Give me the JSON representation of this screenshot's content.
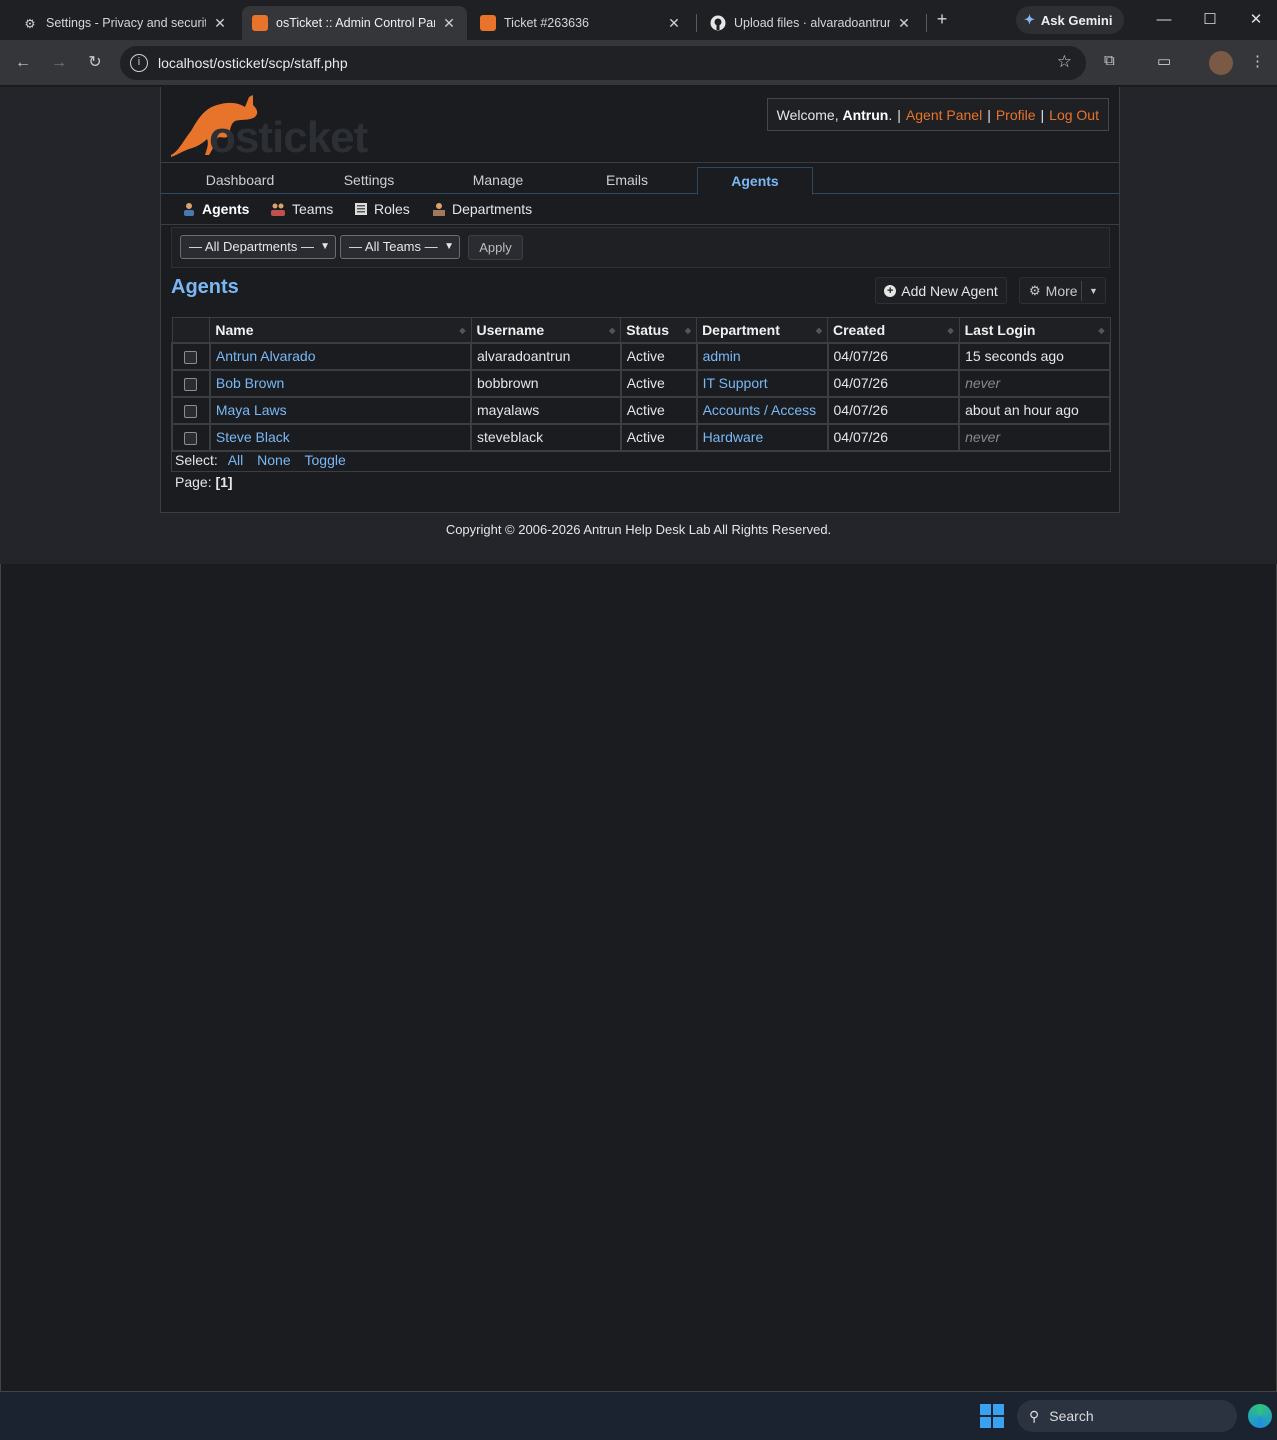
{
  "browser": {
    "tabs": [
      {
        "title": "Settings - Privacy and security",
        "icon": "gear-icon"
      },
      {
        "title": "osTicket :: Admin Control Panel",
        "icon": "osticket-icon"
      },
      {
        "title": "Ticket #263636",
        "icon": "osticket-icon"
      },
      {
        "title": "Upload files · alvaradoantrun/",
        "icon": "github-icon"
      }
    ],
    "gemini_label": "Ask Gemini",
    "url": "localhost/osticket/scp/staff.php"
  },
  "header": {
    "logo_text": "osticket",
    "welcome_prefix": "Welcome,",
    "user_name": "Antrun",
    "welcome_suffix": ".",
    "links": [
      "Agent Panel",
      "Profile",
      "Log Out"
    ]
  },
  "nav": {
    "tabs": [
      "Dashboard",
      "Settings",
      "Manage",
      "Emails",
      "Agents"
    ],
    "active": "Agents"
  },
  "subnav": {
    "items": [
      "Agents",
      "Teams",
      "Roles",
      "Departments"
    ],
    "active": "Agents"
  },
  "filters": {
    "department": "— All Departments —",
    "team": "— All Teams —",
    "apply_label": "Apply"
  },
  "main": {
    "title": "Agents",
    "add_label": "Add New Agent",
    "more_label": "More"
  },
  "table": {
    "columns": [
      "Name",
      "Username",
      "Status",
      "Department",
      "Created",
      "Last Login"
    ],
    "rows": [
      {
        "name": "Antrun Alvarado",
        "username": "alvaradoantrun",
        "status": "Active",
        "department": "admin",
        "created": "04/07/26",
        "last_login": "15 seconds ago"
      },
      {
        "name": "Bob Brown",
        "username": "bobbrown",
        "status": "Active",
        "department": "IT Support",
        "created": "04/07/26",
        "last_login": "never"
      },
      {
        "name": "Maya Laws",
        "username": "mayalaws",
        "status": "Active",
        "department": "Accounts / Access",
        "created": "04/07/26",
        "last_login": "about an hour ago"
      },
      {
        "name": "Steve Black",
        "username": "steveblack",
        "status": "Active",
        "department": "Hardware",
        "created": "04/07/26",
        "last_login": "never"
      }
    ],
    "select_label": "Select:",
    "select_links": [
      "All",
      "None",
      "Toggle"
    ],
    "page_label": "Page:",
    "page_value": "[1]"
  },
  "footer": {
    "copyright": "Copyright © 2006-2026 Antrun Help Desk Lab All Rights Reserved."
  },
  "taskbar": {
    "search_label": "Search"
  },
  "colors": {
    "accent": "#7ab8f5",
    "brand": "#e8742b",
    "background": "#1a1c20"
  }
}
